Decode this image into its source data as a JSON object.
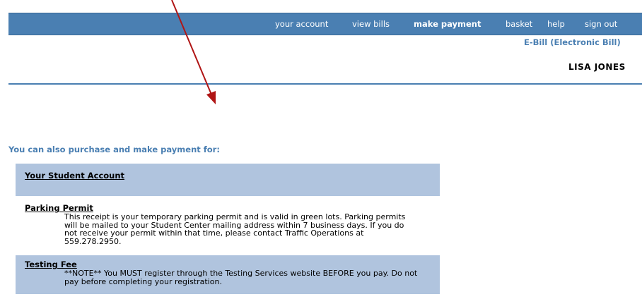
{
  "nav": {
    "items": [
      {
        "label": "your account",
        "active": false
      },
      {
        "label": "view bills",
        "active": false
      },
      {
        "label": "make payment",
        "active": true
      },
      {
        "label": "basket",
        "active": false
      },
      {
        "label": "help",
        "active": false
      },
      {
        "label": "sign out",
        "active": false
      }
    ]
  },
  "header": {
    "ebill_link": "E-Bill (Electronic Bill)",
    "user_name": "LISA JONES"
  },
  "section": {
    "heading": "You can also purchase and make payment for:",
    "items": [
      {
        "title": "Your Student Account",
        "description": ""
      },
      {
        "title": "Parking Permit",
        "description": "This receipt is your temporary parking permit and is valid in green lots. Parking permits will be mailed to your Student Center mailing address within 7 business days. If you do not receive your permit within that time, please contact Traffic Operations at 559.278.2950."
      },
      {
        "title": "Testing Fee",
        "description": "**NOTE** You MUST register through the Testing Services website BEFORE you pay. Do not pay before completing your registration."
      }
    ]
  },
  "colors": {
    "nav_bg": "#4a7fb2",
    "shaded_row": "#b0c4de",
    "accent_text": "#4a7fb2",
    "annotation_arrow": "#b01515"
  }
}
